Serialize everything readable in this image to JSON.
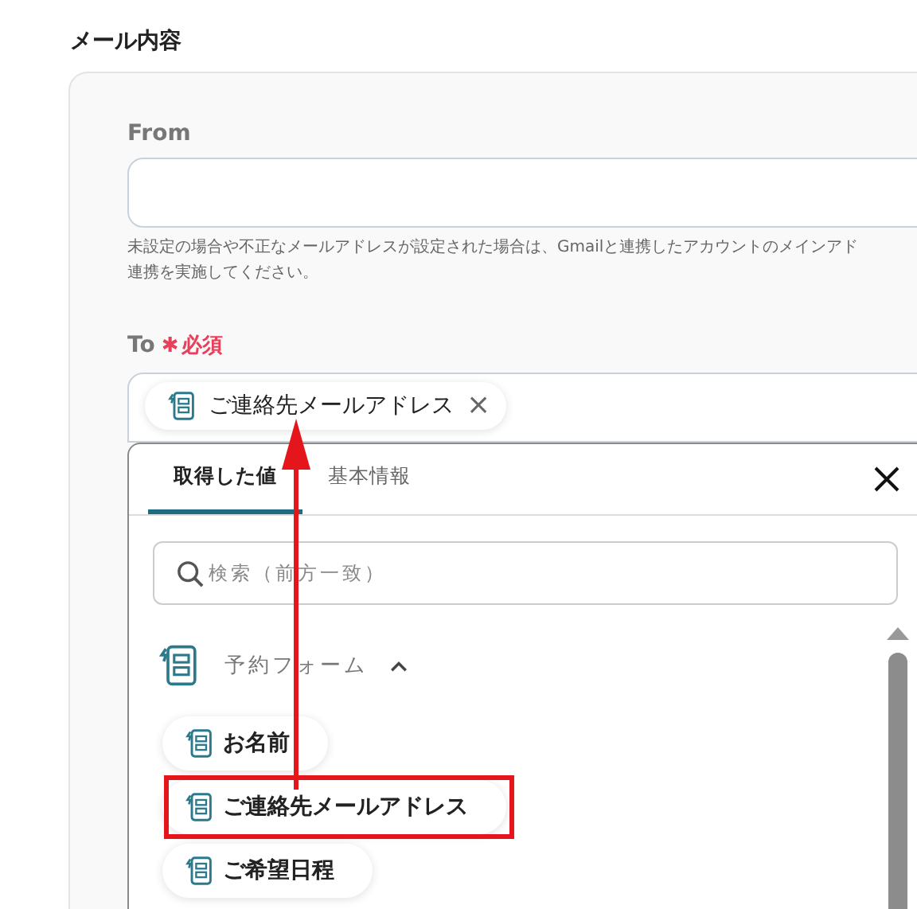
{
  "section_title": "メール内容",
  "from": {
    "label": "From",
    "help_lines": [
      "未設定の場合や不正なメールアドレスが設定された場合は、Gmailと連携したアカウントのメインアド",
      "連携を実施してください。"
    ]
  },
  "to": {
    "label": "To",
    "required_mark": "✱",
    "required_label": "必須",
    "chips": [
      {
        "label": "ご連絡先メールアドレス",
        "remove": "×"
      }
    ]
  },
  "picker": {
    "tabs": [
      {
        "label": "取得した値",
        "selected": true
      },
      {
        "label": "基本情報",
        "selected": false
      }
    ],
    "search": {
      "placeholder": "検索（前方一致）"
    },
    "groups": [
      {
        "label": "予約フォーム",
        "expanded": true,
        "items": [
          {
            "label": "お名前",
            "highlighted": false
          },
          {
            "label": "ご連絡先メールアドレス",
            "highlighted": true
          },
          {
            "label": "ご希望日程",
            "highlighted": false
          }
        ]
      }
    ]
  },
  "annotation_arrow": true
}
